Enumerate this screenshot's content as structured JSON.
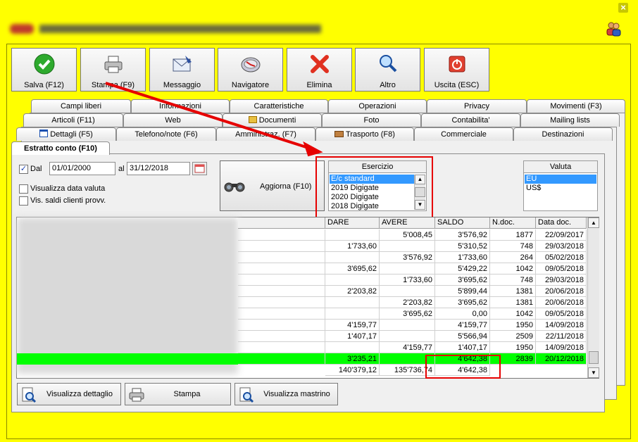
{
  "window": {
    "close_glyph": "×"
  },
  "toolbar": [
    {
      "label": "Salva (F12)",
      "icon": "check-icon"
    },
    {
      "label": "Stampa (F9)",
      "icon": "printer-icon"
    },
    {
      "label": "Messaggio",
      "icon": "envelope-icon"
    },
    {
      "label": "Navigatore",
      "icon": "compass-icon"
    },
    {
      "label": "Elimina",
      "icon": "delete-x-icon"
    },
    {
      "label": "Altro",
      "icon": "magnifier-icon"
    },
    {
      "label": "Uscita (ESC)",
      "icon": "power-icon"
    }
  ],
  "tabs_row1": [
    "Campi liberi",
    "Informazioni",
    "Caratteristiche",
    "Operazioni",
    "Privacy",
    "Movimenti (F3)"
  ],
  "tabs_row2": [
    "Articoli (F11)",
    "Web",
    "Documenti",
    "Foto",
    "Contabilita'",
    "Mailing lists"
  ],
  "tabs_row3": [
    "Dettagli (F5)",
    "Telefono/note (F6)",
    "Amministraz. (F7)",
    "Trasporto (F8)",
    "Commerciale",
    "Destinazioni"
  ],
  "active_tab": "Estratto conto (F10)",
  "filters": {
    "dal_label": "Dal",
    "dal_checked": true,
    "dal_value": "01/01/2000",
    "al_label": "al",
    "al_value": "31/12/2018",
    "visualizza_data_valuta": "Visualizza data valuta",
    "vis_saldi": "Vis. saldi clienti provv."
  },
  "aggiorna_label": "Aggiorna (F10)",
  "esercizio": {
    "title": "Esercizio",
    "items": [
      "E/c standard",
      "2019 Digigate",
      "2020 Digigate",
      "2018 Digigate"
    ],
    "selected": 0
  },
  "valuta": {
    "title": "Valuta",
    "items": [
      "EU",
      "US$"
    ],
    "selected": 0
  },
  "grid": {
    "columns": [
      "DARE",
      "AVERE",
      "SALDO",
      "N.doc.",
      "Data doc."
    ],
    "rows": [
      [
        "",
        "5'008,45",
        "3'576,92",
        "1877",
        "22/09/2017"
      ],
      [
        "1'733,60",
        "",
        "5'310,52",
        "748",
        "29/03/2018"
      ],
      [
        "",
        "3'576,92",
        "1'733,60",
        "264",
        "05/02/2018"
      ],
      [
        "3'695,62",
        "",
        "5'429,22",
        "1042",
        "09/05/2018"
      ],
      [
        "",
        "1'733,60",
        "3'695,62",
        "748",
        "29/03/2018"
      ],
      [
        "2'203,82",
        "",
        "5'899,44",
        "1381",
        "20/06/2018"
      ],
      [
        "",
        "2'203,82",
        "3'695,62",
        "1381",
        "20/06/2018"
      ],
      [
        "",
        "3'695,62",
        "0,00",
        "1042",
        "09/05/2018"
      ],
      [
        "4'159,77",
        "",
        "4'159,77",
        "1950",
        "14/09/2018"
      ],
      [
        "1'407,17",
        "",
        "5'566,94",
        "2509",
        "22/11/2018"
      ],
      [
        "",
        "4'159,77",
        "1'407,17",
        "1950",
        "14/09/2018"
      ],
      [
        "3'235,21",
        "",
        "4'642,38",
        "2839",
        "20/12/2018"
      ]
    ],
    "highlight_row": 11,
    "totals": [
      "140'379,12",
      "135'736,74",
      "4'642,38"
    ]
  },
  "bottom_buttons": [
    "Visualizza dettaglio",
    "Stampa",
    "Visualizza mastrino"
  ],
  "colors": {
    "background": "#ffff00",
    "highlight": "#00ff00",
    "annotation": "#e60000",
    "selection": "#3399ff"
  }
}
